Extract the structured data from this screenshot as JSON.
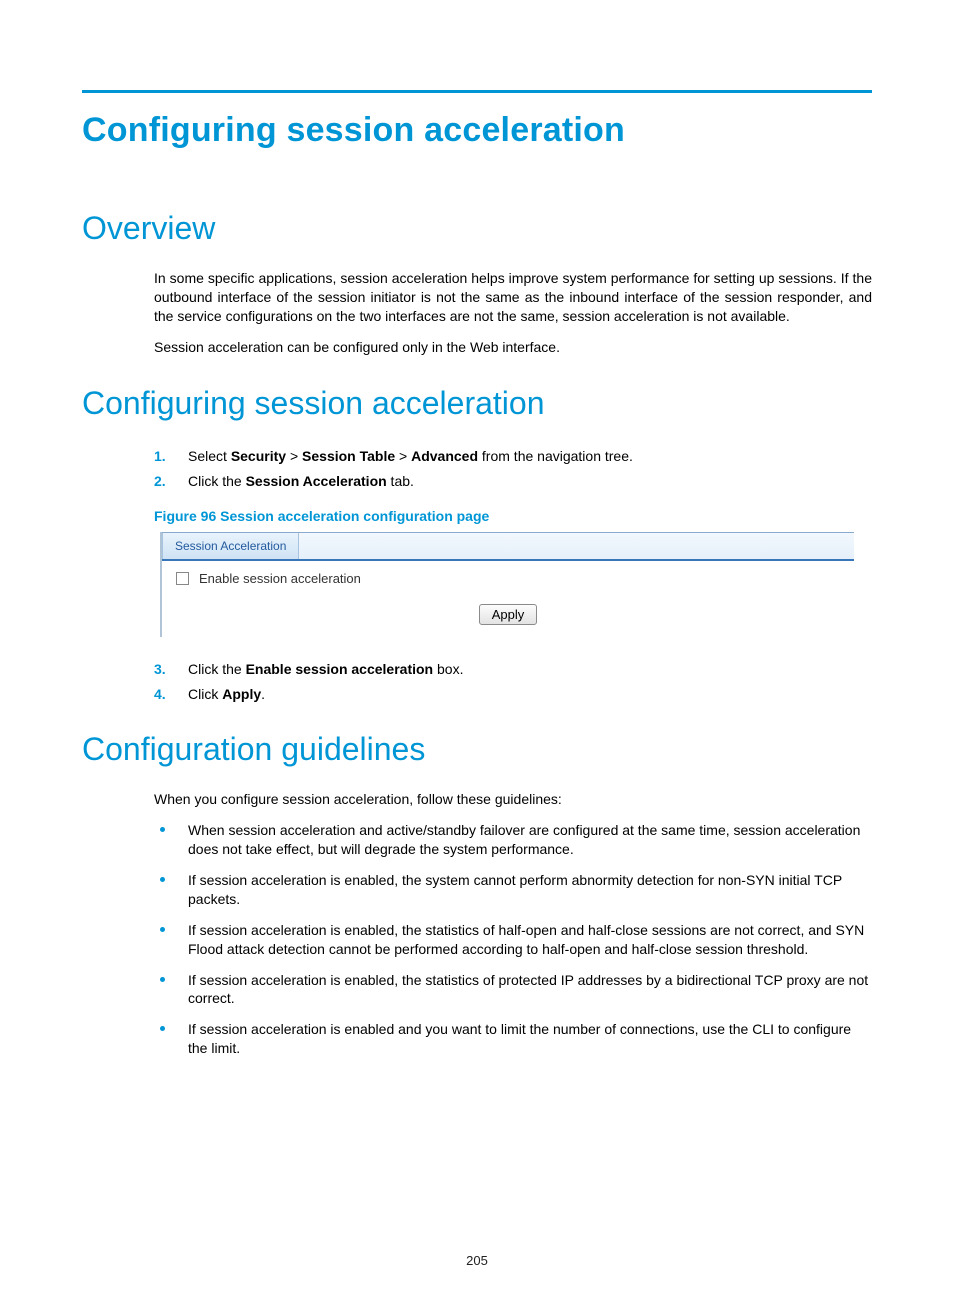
{
  "page": {
    "title": "Configuring session acceleration",
    "pagenum": "205"
  },
  "sections": {
    "overview": {
      "heading": "Overview",
      "p1": "In some specific applications, session acceleration helps improve system performance for setting up sessions. If the outbound interface of the session initiator is not the same as the inbound interface of the session responder, and the service configurations on the two interfaces are not the same, session acceleration is not available.",
      "p2": "Session acceleration can be configured only in the Web interface."
    },
    "config": {
      "heading": "Configuring session acceleration",
      "step1": {
        "num": "1.",
        "pre": "Select ",
        "b1": "Security",
        "gt1": " > ",
        "b2": "Session Table",
        "gt2": " > ",
        "b3": "Advanced",
        "post": " from the navigation tree."
      },
      "step2": {
        "num": "2.",
        "pre": "Click the ",
        "b1": "Session Acceleration",
        "post": " tab."
      },
      "figure_caption": "Figure 96 Session acceleration configuration page",
      "screenshot": {
        "tab_label": "Session Acceleration",
        "checkbox_label": "Enable session acceleration",
        "apply_label": "Apply"
      },
      "step3": {
        "num": "3.",
        "pre": "Click the ",
        "b1": "Enable session acceleration",
        "post": " box."
      },
      "step4": {
        "num": "4.",
        "pre": "Click ",
        "b1": "Apply",
        "post": "."
      }
    },
    "guidelines": {
      "heading": "Configuration guidelines",
      "intro": "When you configure session acceleration, follow these guidelines:",
      "b1": "When session acceleration and active/standby failover are configured at the same time, session acceleration does not take effect, but will degrade the system performance.",
      "b2": "If session acceleration is enabled, the system cannot perform abnormity detection for non-SYN initial TCP packets.",
      "b3": "If session acceleration is enabled, the statistics of half-open and half-close sessions are not correct, and SYN Flood attack detection cannot be performed according to half-open and half-close session threshold.",
      "b4": "If session acceleration is enabled, the statistics of protected IP addresses by a bidirectional TCP proxy are not correct.",
      "b5": "If session acceleration is enabled and you want to limit the number of connections, use the CLI to configure the limit."
    }
  }
}
